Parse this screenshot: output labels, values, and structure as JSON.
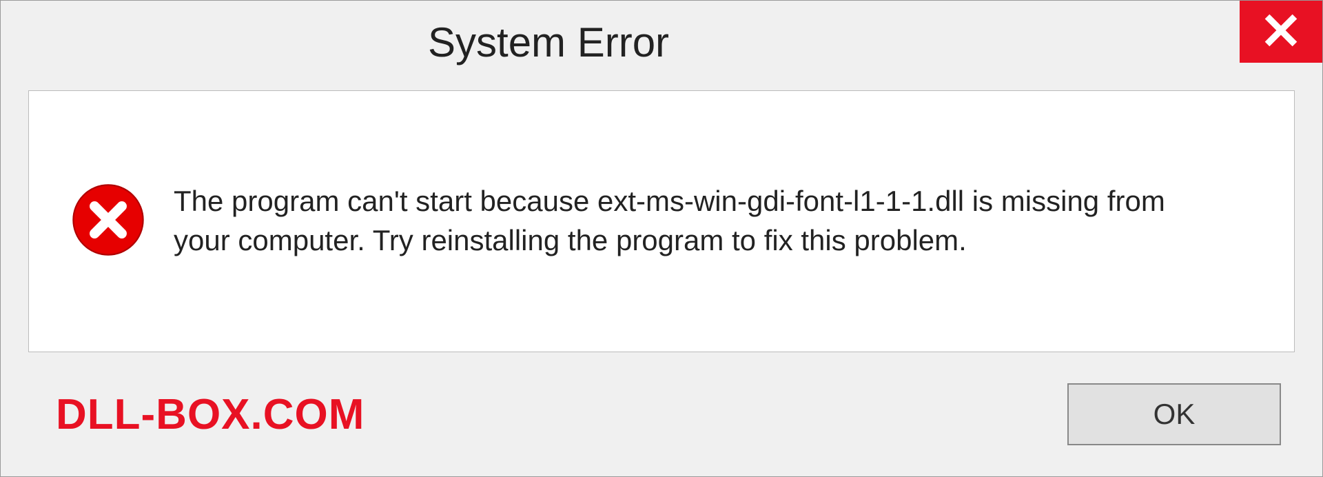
{
  "titlebar": {
    "title": "System Error"
  },
  "message": {
    "text": "The program can't start because ext-ms-win-gdi-font-l1-1-1.dll is missing from your computer. Try reinstalling the program to fix this problem."
  },
  "footer": {
    "watermark": "DLL-BOX.COM",
    "ok_label": "OK"
  },
  "colors": {
    "close_red": "#e81123",
    "watermark_red": "#e81123"
  },
  "icons": {
    "close": "close-icon",
    "error": "error-circle-x-icon"
  }
}
